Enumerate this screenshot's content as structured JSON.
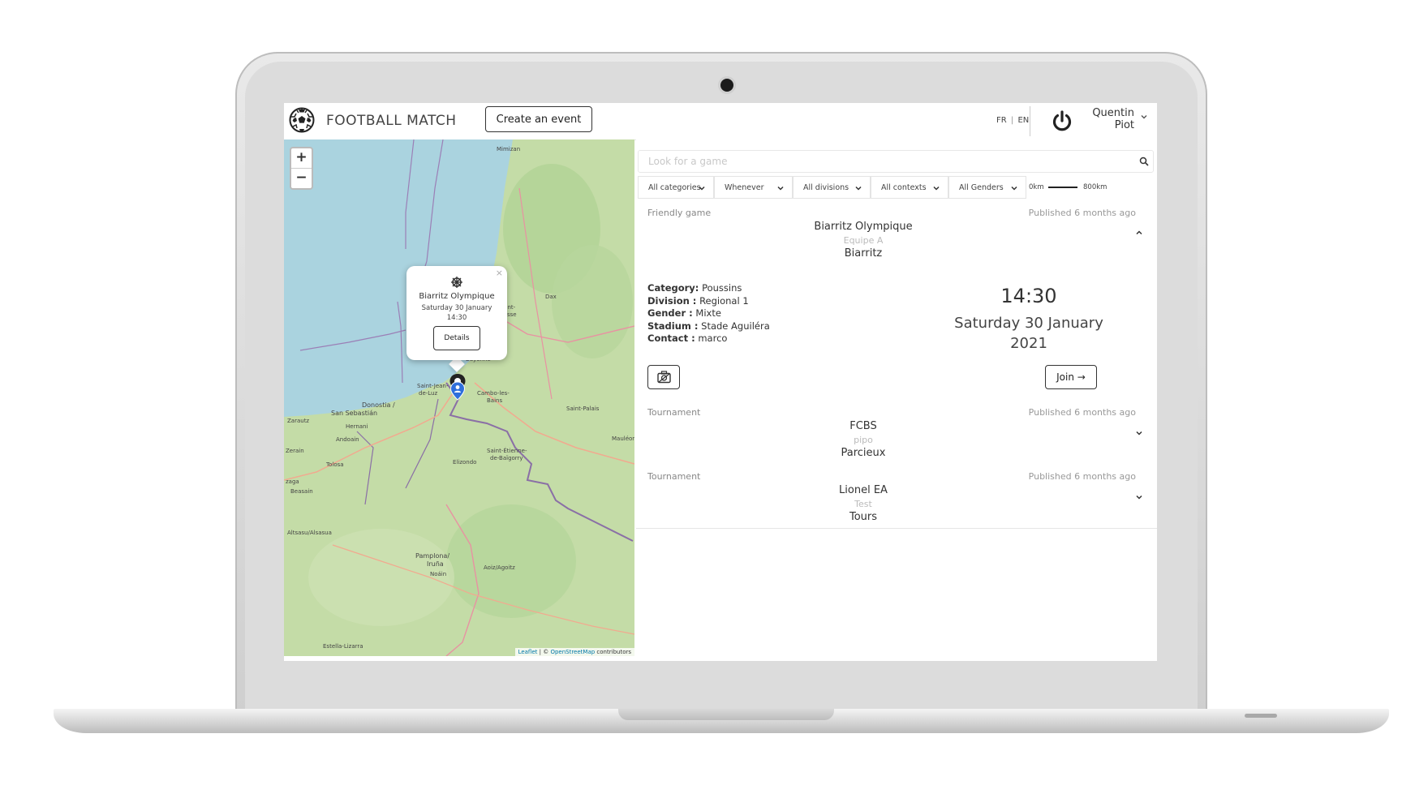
{
  "navbar": {
    "brand": "FOOTBALL MATCH",
    "create_label": "Create an event",
    "lang_fr": "FR",
    "lang_sep": "|",
    "lang_en": "EN",
    "user_first": "Quentin",
    "user_last": "Piot"
  },
  "map": {
    "zoom_in": "+",
    "zoom_out": "−",
    "popup": {
      "close": "×",
      "team": "Biarritz Olympique",
      "date": "Saturday 30 January",
      "time": "14:30",
      "details_label": "Details"
    },
    "attribution_leaflet": "Leaflet",
    "attribution_sep": " | © ",
    "attribution_osm": "OpenStreetMap",
    "attribution_rest": " contributors"
  },
  "search": {
    "placeholder": "Look for a game"
  },
  "filters": {
    "category": "All categories",
    "when": "Whenever",
    "division": "All divisions",
    "context": "All contexts",
    "gender": "All Genders",
    "range_min": "0km",
    "range_max": "800km"
  },
  "events": [
    {
      "type": "Friendly game",
      "published": "Published 6 months ago",
      "team": "Biarritz Olympique",
      "sub": "Equipe A",
      "city": "Biarritz",
      "details": {
        "category_label": "Category:",
        "category": "Poussins",
        "division_label": "Division :",
        "division": "Regional 1",
        "gender_label": "Gender :",
        "gender": "Mixte",
        "stadium_label": "Stadium :",
        "stadium": "Stade Aguiléra",
        "contact_label": "Contact :",
        "contact": "marco"
      },
      "time": "14:30",
      "date_line1": "Saturday 30 January",
      "date_line2": "2021",
      "join_label": "Join →"
    },
    {
      "type": "Tournament",
      "published": "Published 6 months ago",
      "team": "FCBS",
      "sub": "pipo",
      "city": "Parcieux"
    },
    {
      "type": "Tournament",
      "published": "Published 6 months ago",
      "team": "Lionel EA",
      "sub": "Test",
      "city": "Tours"
    }
  ],
  "colors": {
    "sea": "#aad3df",
    "land": "#c4dca7",
    "marker": "#2f6fdc"
  }
}
